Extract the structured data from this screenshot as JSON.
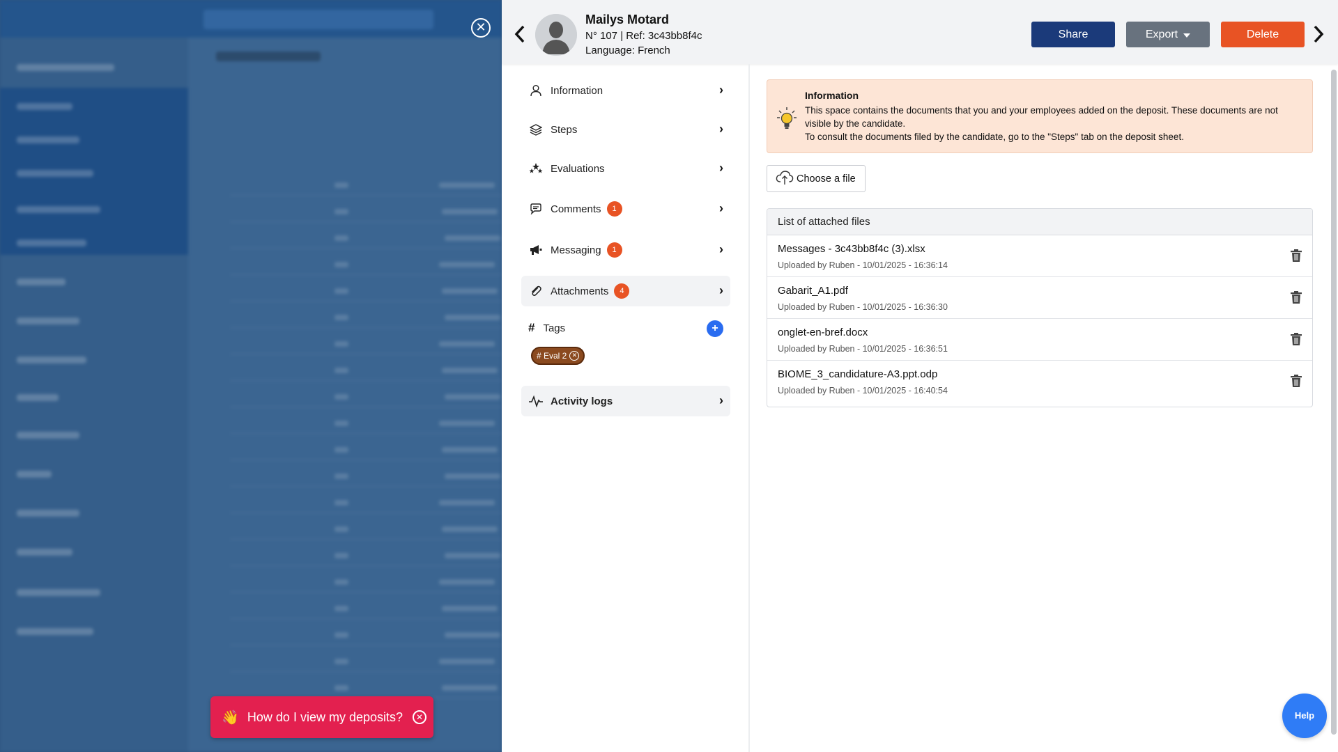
{
  "background": {
    "help_prompt": "How do I view my deposits?",
    "wave_emoji": "👋"
  },
  "header": {
    "name": "Mailys Motard",
    "ref_line": "N° 107 | Ref: 3c43bb8f4c",
    "language_line": "Language: French",
    "share_label": "Share",
    "export_label": "Export",
    "delete_label": "Delete",
    "colors": {
      "share": "#1b3a7a",
      "export": "#68727e",
      "delete": "#e85324"
    }
  },
  "nav": {
    "items": [
      {
        "label": "Information",
        "icon": "user-icon",
        "badge": ""
      },
      {
        "label": "Steps",
        "icon": "layers-icon",
        "badge": ""
      },
      {
        "label": "Evaluations",
        "icon": "stars-icon",
        "badge": ""
      },
      {
        "label": "Comments",
        "icon": "chat-icon",
        "badge": "1"
      },
      {
        "label": "Messaging",
        "icon": "megaphone-icon",
        "badge": "1"
      },
      {
        "label": "Attachments",
        "icon": "paperclip-icon",
        "badge": "4",
        "active": true
      }
    ],
    "tags_label": "Tags",
    "tags_add": "+",
    "tags": [
      {
        "label": "# Eval 2"
      }
    ],
    "activity_label": "Activity logs"
  },
  "content": {
    "info_title": "Information",
    "info_line1": "This space contains the documents that you and your employees added on the deposit. These documents are not visible by the candidate.",
    "info_line2": "To consult the documents filed by the candidate, go to the \"Steps\" tab on the deposit sheet.",
    "choose_file_label": "Choose a file",
    "files_header": "List of attached files",
    "files": [
      {
        "name": "Messages - 3c43bb8f4c (3).xlsx",
        "meta": "Uploaded by Ruben - 10/01/2025 - 16:36:14"
      },
      {
        "name": "Gabarit_A1.pdf",
        "meta": "Uploaded by Ruben - 10/01/2025 - 16:36:30"
      },
      {
        "name": "onglet-en-bref.docx",
        "meta": "Uploaded by Ruben - 10/01/2025 - 16:36:51"
      },
      {
        "name": "BIOME_3_candidature-A3.ppt.odp",
        "meta": "Uploaded by Ruben - 10/01/2025 - 16:40:54"
      }
    ]
  },
  "help_label": "Help"
}
